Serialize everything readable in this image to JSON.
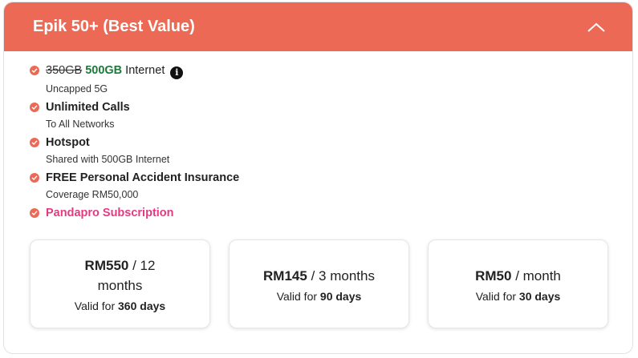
{
  "plan": {
    "title": "Epik 50+ (Best Value)",
    "toggle_icon": "chevron-up-icon",
    "accent_color": "#ec6a55"
  },
  "features": {
    "internet": {
      "old": "350GB",
      "new": "500GB",
      "suffix": "Internet",
      "info_icon": "i",
      "sub": "Uncapped 5G"
    },
    "calls": {
      "title": "Unlimited Calls",
      "sub": "To All Networks"
    },
    "hotspot": {
      "title": "Hotspot",
      "sub": "Shared with 500GB Internet"
    },
    "insurance": {
      "title": "FREE Personal Accident Insurance",
      "sub": "Coverage RM50,000"
    },
    "pandapro": {
      "title": "Pandapro Subscription",
      "color": "#e53a83"
    }
  },
  "options": [
    {
      "price": "RM550",
      "period_line1": "/ 12",
      "period_line2": "months",
      "valid_prefix": "Valid for",
      "valid_days": "360 days"
    },
    {
      "price": "RM145",
      "period": "/ 3 months",
      "valid_prefix": "Valid for",
      "valid_days": "90 days"
    },
    {
      "price": "RM50",
      "period": "/ month",
      "valid_prefix": "Valid for",
      "valid_days": "30 days"
    }
  ]
}
